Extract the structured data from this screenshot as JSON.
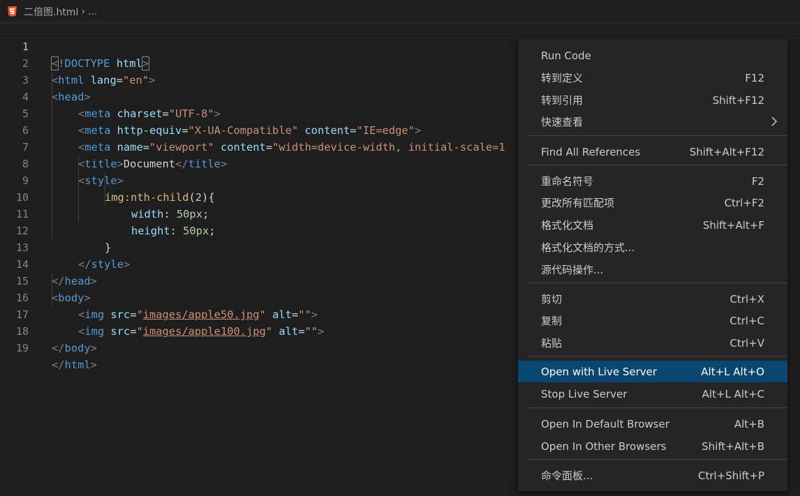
{
  "breadcrumb": {
    "file_name": "二倍图.html",
    "separator": "›",
    "ellipsis": "..."
  },
  "editor": {
    "line_numbers": [
      "1",
      "2",
      "3",
      "4",
      "5",
      "6",
      "7",
      "8",
      "9",
      "10",
      "11",
      "12",
      "13",
      "14",
      "15",
      "16",
      "17",
      "18",
      "19"
    ],
    "active_line": 1
  },
  "code": {
    "l1": {
      "open": "<",
      "doctype": "!DOCTYPE",
      "sp": " ",
      "html": "html",
      "close": ">"
    },
    "l2": {
      "lt": "<",
      "tag": "html",
      "sp": " ",
      "attr": "lang",
      "eq": "=",
      "val": "\"en\"",
      "gt": ">"
    },
    "l3": {
      "lt": "<",
      "tag": "head",
      "gt": ">"
    },
    "l4": {
      "lt": "<",
      "tag": "meta",
      "sp": " ",
      "attr": "charset",
      "eq": "=",
      "val": "\"UTF-8\"",
      "gt": ">"
    },
    "l5": {
      "lt": "<",
      "tag": "meta",
      "sp": " ",
      "attr1": "http-equiv",
      "eq1": "=",
      "val1": "\"X-UA-Compatible\"",
      "sp2": " ",
      "attr2": "content",
      "eq2": "=",
      "val2": "\"IE=edge\"",
      "gt": ">"
    },
    "l6": {
      "lt": "<",
      "tag": "meta",
      "sp": " ",
      "attr1": "name",
      "eq1": "=",
      "val1": "\"viewport\"",
      "sp2": " ",
      "attr2": "content",
      "eq2": "=",
      "val2": "\"width=device-width, initial-scale=1"
    },
    "l7": {
      "lt": "<",
      "tag": "title",
      "gt": ">",
      "text": "Document",
      "lt2": "</",
      "tag2": "title",
      "gt2": ">"
    },
    "l8": {
      "lt": "<",
      "tag": "style",
      "gt": ">"
    },
    "l9": {
      "sel": "img:nth-child",
      "po": "(",
      "num": "2",
      "pc": ")",
      "brace": "{"
    },
    "l10": {
      "prop": "width",
      "colon": ": ",
      "val": "50px",
      "semi": ";"
    },
    "l11": {
      "prop": "height",
      "colon": ": ",
      "val": "50px",
      "semi": ";"
    },
    "l12": {
      "brace": "}"
    },
    "l13": {
      "lt": "</",
      "tag": "style",
      "gt": ">"
    },
    "l14": {
      "lt": "</",
      "tag": "head",
      "gt": ">"
    },
    "l15": {
      "lt": "<",
      "tag": "body",
      "gt": ">"
    },
    "l16": {
      "lt": "<",
      "tag": "img",
      "sp": " ",
      "attr1": "src",
      "eq1": "=",
      "q1": "\"",
      "link": "images/apple50.jpg",
      "q2": "\"",
      "sp2": " ",
      "attr2": "alt",
      "eq2": "=",
      "val2": "\"\"",
      "gt": ">"
    },
    "l17": {
      "lt": "<",
      "tag": "img",
      "sp": " ",
      "attr1": "src",
      "eq1": "=",
      "q1": "\"",
      "link": "images/apple100.jpg",
      "q2": "\"",
      "sp2": " ",
      "attr2": "alt",
      "eq2": "=",
      "val2": "\"\"",
      "gt": ">"
    },
    "l18": {
      "lt": "</",
      "tag": "body",
      "gt": ">"
    },
    "l19": {
      "lt": "</",
      "tag": "html",
      "gt": ">"
    }
  },
  "context_menu": {
    "items": [
      {
        "label": "Run Code",
        "key": ""
      },
      {
        "label": "转到定义",
        "key": "F12"
      },
      {
        "label": "转到引用",
        "key": "Shift+F12"
      },
      {
        "label": "快速查看",
        "key": ""
      },
      {
        "label": "Find All References",
        "key": "Shift+Alt+F12"
      },
      {
        "label": "重命名符号",
        "key": "F2"
      },
      {
        "label": "更改所有匹配项",
        "key": "Ctrl+F2"
      },
      {
        "label": "格式化文档",
        "key": "Shift+Alt+F"
      },
      {
        "label": "格式化文档的方式...",
        "key": ""
      },
      {
        "label": "源代码操作...",
        "key": ""
      },
      {
        "label": "剪切",
        "key": "Ctrl+X"
      },
      {
        "label": "复制",
        "key": "Ctrl+C"
      },
      {
        "label": "粘贴",
        "key": "Ctrl+V"
      },
      {
        "label": "Open with Live Server",
        "key": "Alt+L Alt+O"
      },
      {
        "label": "Stop Live Server",
        "key": "Alt+L Alt+C"
      },
      {
        "label": "Open In Default Browser",
        "key": "Alt+B"
      },
      {
        "label": "Open In Other Browsers",
        "key": "Shift+Alt+B"
      },
      {
        "label": "命令面板...",
        "key": "Ctrl+Shift+P"
      }
    ],
    "highlighted_label": "Open with Live Server"
  },
  "colors": {
    "background": "#1e1e1e",
    "menu_background": "#252526",
    "menu_highlight": "#094771",
    "html5_orange": "#e44d26"
  },
  "icons": {
    "file_icon": "html5-icon",
    "submenu_icon": "chevron-right-icon"
  }
}
